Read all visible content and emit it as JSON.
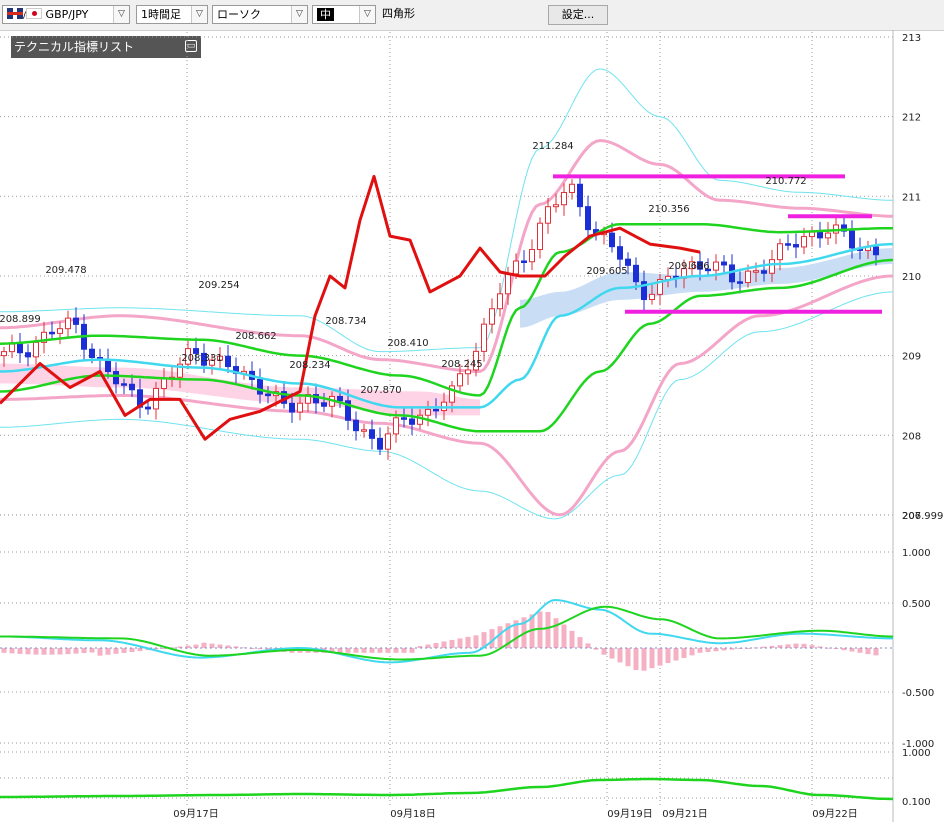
{
  "toolbar": {
    "pair": "GBP/JPY",
    "timeframe": "1時間足",
    "chart_type": "ローソク",
    "line_width": "中",
    "drawing_tool": "四角形",
    "settings_button": "設定..."
  },
  "indicator_panel": {
    "title": "テクニカル指標リスト"
  },
  "colors": {
    "candle_up": "#e0303a",
    "candle_down": "#1c2fd6",
    "bollinger_outer": "#6fe3ef",
    "bollinger_inner": "#f4a6c8",
    "ichimoku_cloud": "#c9ddf5",
    "cloud_span": "#ffd3e6",
    "moving_avg_fast": "#40d8ee",
    "moving_avg_slow": "#1fd41f",
    "red_line": "#e01010",
    "drawn_lines": "#f020e0",
    "macd_hist": "#f6b0c4"
  },
  "chart_data": [
    {
      "type": "candlestick",
      "price_axis": {
        "ticks": [
          "213",
          "212",
          "211",
          "210",
          "209",
          "208",
          "207",
          "206.999"
        ],
        "range": [
          206.999,
          213.2
        ]
      },
      "time_labels": [
        "09月17日",
        "09月18日",
        "09月19日",
        "09月21日",
        "09月22日"
      ],
      "price_annotations": [
        "209.478",
        "208.899",
        "208.331",
        "209.254",
        "208.662",
        "208.234",
        "208.734",
        "208.410",
        "207.870",
        "208.245",
        "211.284",
        "209.605",
        "210.356",
        "209.686",
        "210.772"
      ],
      "horizontal_lines": [
        211.25,
        210.75,
        209.55
      ],
      "candles_close_sample": [
        209.0,
        209.1,
        209.3,
        209.4,
        208.9,
        208.6,
        208.4,
        208.7,
        209.1,
        208.9,
        208.8,
        208.6,
        208.3,
        208.5,
        208.4,
        208.1,
        207.9,
        208.2,
        208.3,
        208.5,
        209.1,
        209.8,
        210.2,
        210.8,
        211.1,
        210.6,
        210.3,
        209.8,
        209.9,
        210.1,
        210.2,
        209.9,
        210.1,
        210.3,
        210.5,
        210.6,
        210.4,
        210.3
      ],
      "indicators": [
        "Bollinger Bands",
        "Ichimoku Cloud",
        "Moving Averages"
      ]
    },
    {
      "type": "line",
      "name": "MACD",
      "y_ticks": [
        "1.000",
        "0.500",
        "-0.500",
        "-1.000"
      ],
      "ylim": [
        -1.0,
        1.0
      ]
    },
    {
      "type": "line",
      "name": "sub-oscillator",
      "y_ticks": [
        "1.000",
        "0.100"
      ]
    }
  ]
}
